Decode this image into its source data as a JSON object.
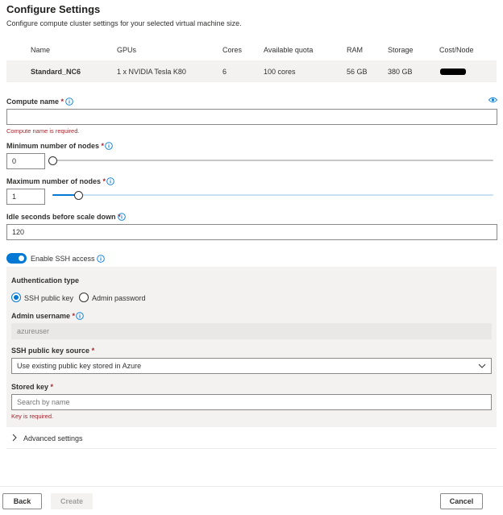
{
  "header": {
    "title": "Configure Settings",
    "subtitle": "Configure compute cluster settings for your selected virtual machine size."
  },
  "vm_table": {
    "columns": [
      "Name",
      "GPUs",
      "Cores",
      "Available quota",
      "RAM",
      "Storage",
      "Cost/Node"
    ],
    "row": {
      "name": "Standard_NC6",
      "gpus": "1 x NVIDIA Tesla K80",
      "cores": "6",
      "quota": "100 cores",
      "ram": "56 GB",
      "storage": "380 GB"
    }
  },
  "compute_name": {
    "label": "Compute name",
    "required_mark": "*",
    "value": "",
    "error": "Compute name is required."
  },
  "min_nodes": {
    "label": "Minimum number of nodes",
    "required_mark": "*",
    "value": "0",
    "slider_fraction": 0.0
  },
  "max_nodes": {
    "label": "Maximum number of nodes",
    "required_mark": "*",
    "value": "1",
    "slider_fraction": 0.06
  },
  "idle_seconds": {
    "label": "Idle seconds before scale down",
    "required_mark": "*",
    "value": "120"
  },
  "ssh": {
    "toggle_label": "Enable SSH access",
    "enabled": true,
    "auth_type_label": "Authentication type",
    "options": [
      "SSH public key",
      "Admin password"
    ],
    "selected_option": "SSH public key",
    "admin_username_label": "Admin username",
    "admin_username_required": "*",
    "admin_username_value": "azureuser",
    "key_source_label": "SSH public key source",
    "key_source_required": "*",
    "key_source_value": "Use existing public key stored in Azure",
    "stored_key_label": "Stored key",
    "stored_key_required": "*",
    "stored_key_placeholder": "Search by name",
    "stored_key_error": "Key is required."
  },
  "advanced": {
    "label": "Advanced settings"
  },
  "footer": {
    "back_label": "Back",
    "create_label": "Create",
    "cancel_label": "Cancel"
  },
  "colors": {
    "accent": "#0078d4",
    "error": "#a4262c",
    "panel": "#f3f2f1",
    "disabled": "#f3f2f1"
  }
}
